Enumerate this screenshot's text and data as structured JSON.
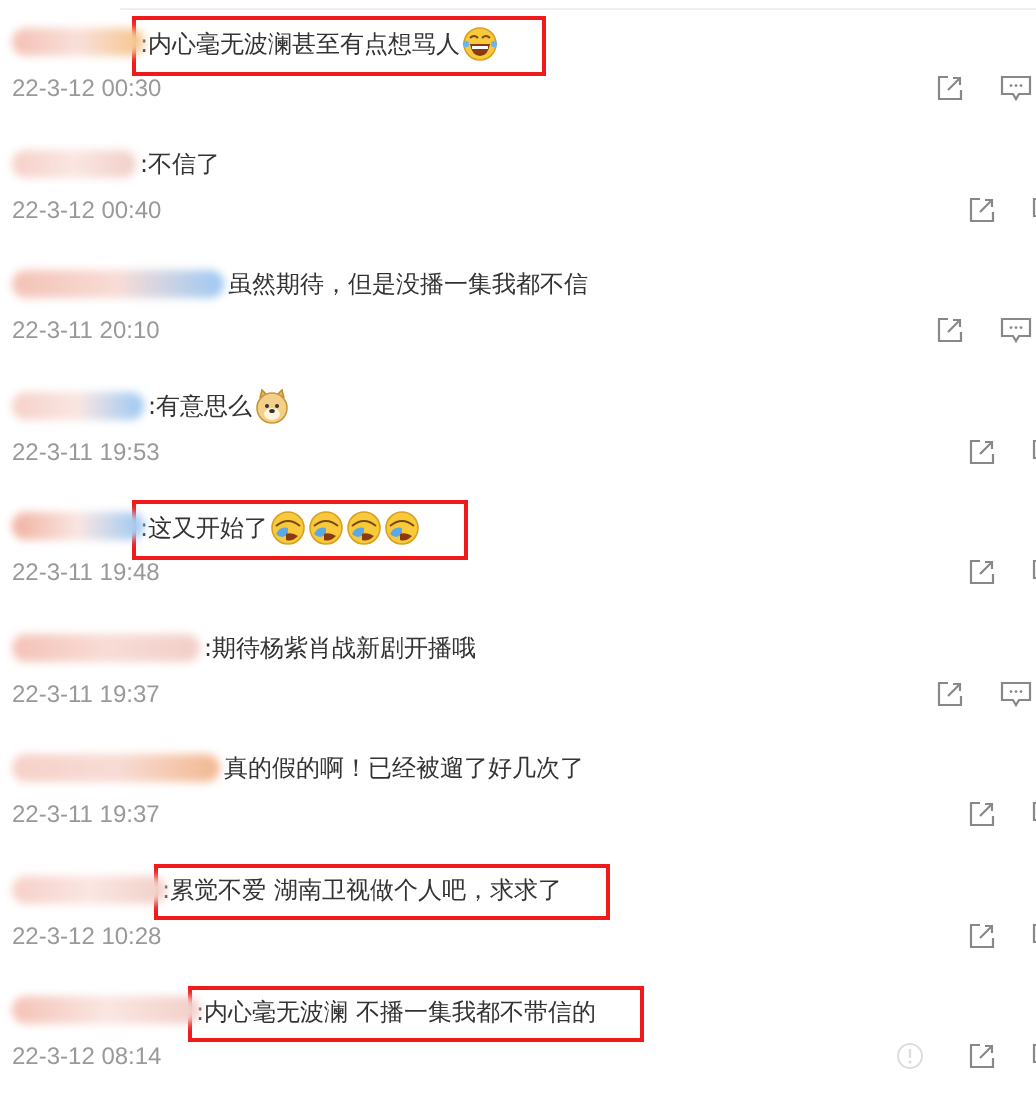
{
  "comments": [
    {
      "text": ":内心毫无波澜甚至有点想骂人",
      "emojis": [
        {
          "kind": "laugh-cry"
        }
      ],
      "time": "22-3-12 00:30",
      "highlighted": true,
      "reply_full": true,
      "report_icon": false
    },
    {
      "text": ":不信了",
      "time": "22-3-12 00:40",
      "highlighted": false,
      "reply_full": false,
      "report_icon": false
    },
    {
      "text": "虽然期待，但是没播一集我都不信",
      "time": "22-3-11 20:10",
      "highlighted": false,
      "reply_full": true,
      "report_icon": false
    },
    {
      "text": ":有意思么",
      "emojis": [
        {
          "kind": "dog"
        }
      ],
      "time": "22-3-11 19:53",
      "highlighted": false,
      "reply_full": false,
      "report_icon": false
    },
    {
      "text": ":这又开始了",
      "emojis": [
        {
          "kind": "cover-face"
        },
        {
          "kind": "cover-face"
        },
        {
          "kind": "cover-face"
        },
        {
          "kind": "cover-face"
        }
      ],
      "time": "22-3-11 19:48",
      "highlighted": true,
      "reply_full": false,
      "report_icon": false
    },
    {
      "text": ":期待杨紫肖战新剧开播哦",
      "time": "22-3-11 19:37",
      "highlighted": false,
      "reply_full": true,
      "report_icon": false
    },
    {
      "text": "真的假的啊！已经被遛了好几次了",
      "time": "22-3-11 19:37",
      "highlighted": false,
      "reply_full": false,
      "report_icon": false
    },
    {
      "text": ":累觉不爱 湖南卫视做个人吧，求求了",
      "time": "22-3-12 10:28",
      "highlighted": true,
      "reply_full": false,
      "report_icon": false
    },
    {
      "text": ":内心毫无波澜 不播一集我都不带信的",
      "time": "22-3-12 08:14",
      "highlighted": true,
      "reply_full": false,
      "report_icon": true
    }
  ]
}
